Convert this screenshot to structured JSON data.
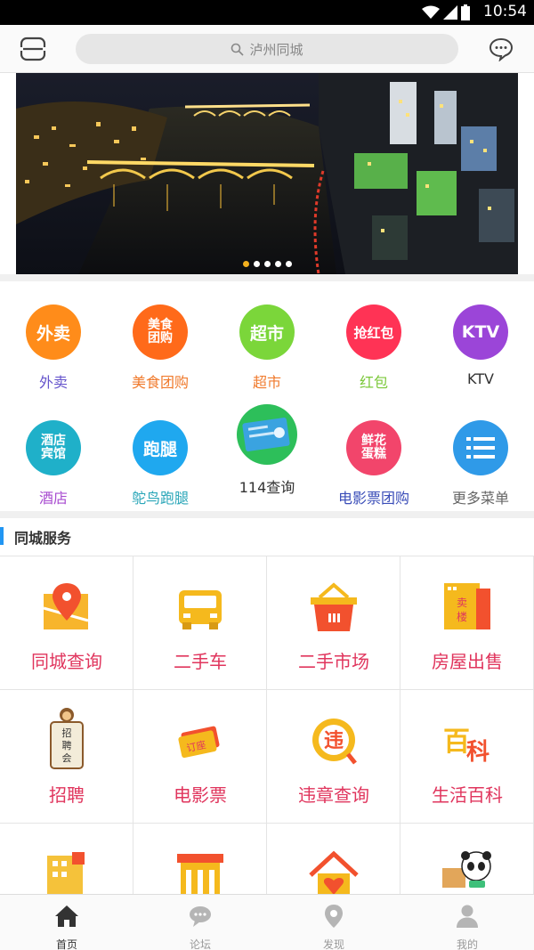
{
  "status_bar": {
    "time": "10:54"
  },
  "header": {
    "search_placeholder": "泸州同城"
  },
  "banner": {
    "slide_count": 5,
    "active_slide": 1
  },
  "quick_menu": [
    {
      "label": "外卖",
      "icon_text": "外卖",
      "color": "#ff8c1a",
      "label_color": "#6655cc"
    },
    {
      "label": "美食团购",
      "icon_text": "美食\n团购",
      "color": "#ff6a1a",
      "label_color": "#f07a2c"
    },
    {
      "label": "超市",
      "icon_text": "超市",
      "color": "#7bd63a",
      "label_color": "#f07a2c"
    },
    {
      "label": "红包",
      "icon_text": "抢红包",
      "color": "#ff3355",
      "label_color": "#7bc83a"
    },
    {
      "label": "KTV",
      "icon_text": "KTV",
      "color": "#9b45d8",
      "label_color": "#333333"
    },
    {
      "label": "酒店",
      "icon_text": "酒店\n宾馆",
      "color": "#1fb0c9",
      "label_color": "#a84cd0"
    },
    {
      "label": "鸵鸟跑腿",
      "icon_text": "跑腿",
      "color": "#1fa8ef",
      "label_color": "#2aa6b8"
    },
    {
      "label": "114查询",
      "icon_text": "",
      "color": "#2dbf5a",
      "label_color": "#333333"
    },
    {
      "label": "电影票团购",
      "icon_text": "鲜花\n蛋糕",
      "color": "#f2456b",
      "label_color": "#3a4db8"
    },
    {
      "label": "更多菜单",
      "icon_text": "",
      "color": "#2f9ae8",
      "label_color": "#666666"
    }
  ],
  "section": {
    "title": "同城服务"
  },
  "services": [
    {
      "label": "同城查询",
      "icon": "map-pin-icon"
    },
    {
      "label": "二手车",
      "icon": "car-icon"
    },
    {
      "label": "二手市场",
      "icon": "basket-icon"
    },
    {
      "label": "房屋出售",
      "icon": "house-sale-icon",
      "icon_text": "卖楼"
    },
    {
      "label": "招聘",
      "icon": "monkey-sign-icon",
      "icon_text": "招聘会"
    },
    {
      "label": "电影票",
      "icon": "ticket-icon",
      "icon_text": "订座"
    },
    {
      "label": "违章查询",
      "icon": "violation-icon",
      "icon_text": "违"
    },
    {
      "label": "生活百科",
      "icon": "encyclopedia-icon",
      "icon_text": "百科"
    },
    {
      "label": "",
      "icon": "building-icon"
    },
    {
      "label": "",
      "icon": "shop-icon"
    },
    {
      "label": "",
      "icon": "home-heart-icon"
    },
    {
      "label": "",
      "icon": "panda-delivery-icon"
    }
  ],
  "bottom_nav": [
    {
      "label": "首页",
      "icon": "home-icon",
      "active": true
    },
    {
      "label": "论坛",
      "icon": "forum-icon",
      "active": false
    },
    {
      "label": "发现",
      "icon": "discover-icon",
      "active": false
    },
    {
      "label": "我的",
      "icon": "user-icon",
      "active": false
    }
  ]
}
